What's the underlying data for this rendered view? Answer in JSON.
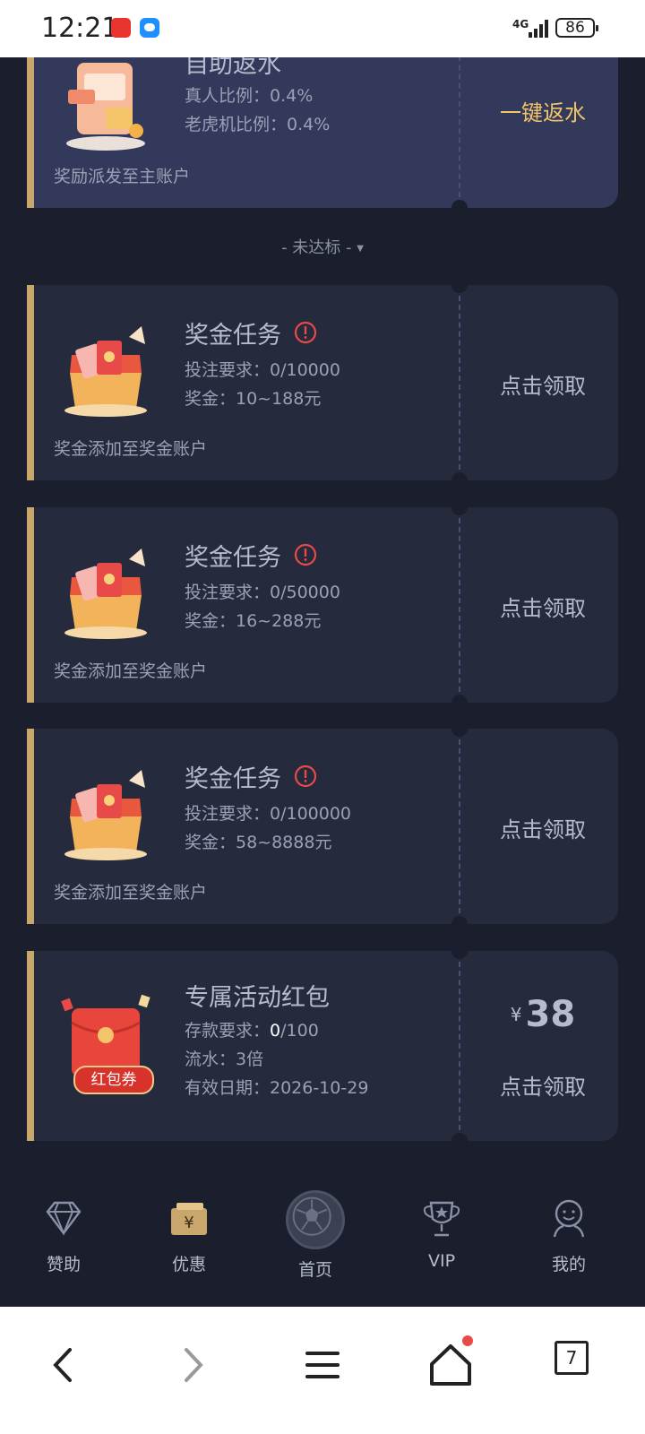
{
  "status_bar": {
    "time": "12:21",
    "network": "4G",
    "battery": "86"
  },
  "rebate_card": {
    "title": "自助返水",
    "line1": "真人比例：0.4%",
    "line2": "老虎机比例：0.4%",
    "footer": "奖励派发至主账户",
    "action": "一键返水"
  },
  "section_label": "- 未达标 -",
  "tasks": [
    {
      "title": "奖金任务",
      "requirement": "投注要求：0/10000",
      "bonus": "奖金：10~188元",
      "footer": "奖金添加至奖金账户",
      "action": "点击领取"
    },
    {
      "title": "奖金任务",
      "requirement": "投注要求：0/50000",
      "bonus": "奖金：16~288元",
      "footer": "奖金添加至奖金账户",
      "action": "点击领取"
    },
    {
      "title": "奖金任务",
      "requirement": "投注要求：0/100000",
      "bonus": "奖金：58~8888元",
      "footer": "奖金添加至奖金账户",
      "action": "点击领取"
    }
  ],
  "redpacket": {
    "title": "专属活动红包",
    "deposit_prefix": "存款要求：",
    "deposit_current": "0",
    "deposit_total": "/100",
    "turnover": "流水：3倍",
    "expiry": "有效日期：2026-10-29",
    "badge": "红包券",
    "currency": "¥",
    "amount": "38",
    "action": "点击领取"
  },
  "bottom_nav": {
    "items": [
      {
        "label": "赞助",
        "icon": "diamond-icon"
      },
      {
        "label": "优惠",
        "icon": "coupon-icon"
      },
      {
        "label": "首页",
        "icon": "soccer-ball-icon"
      },
      {
        "label": "VIP",
        "icon": "trophy-icon"
      },
      {
        "label": "我的",
        "icon": "user-icon"
      }
    ]
  },
  "system_nav": {
    "tab_count": "7"
  },
  "colors": {
    "background": "#1b1f2d",
    "card": "#262a3d",
    "card_highlight": "#33395a",
    "accent_gold": "#f2c56b",
    "border_gold": "#c9a66b",
    "warning_red": "#e84a4a"
  }
}
